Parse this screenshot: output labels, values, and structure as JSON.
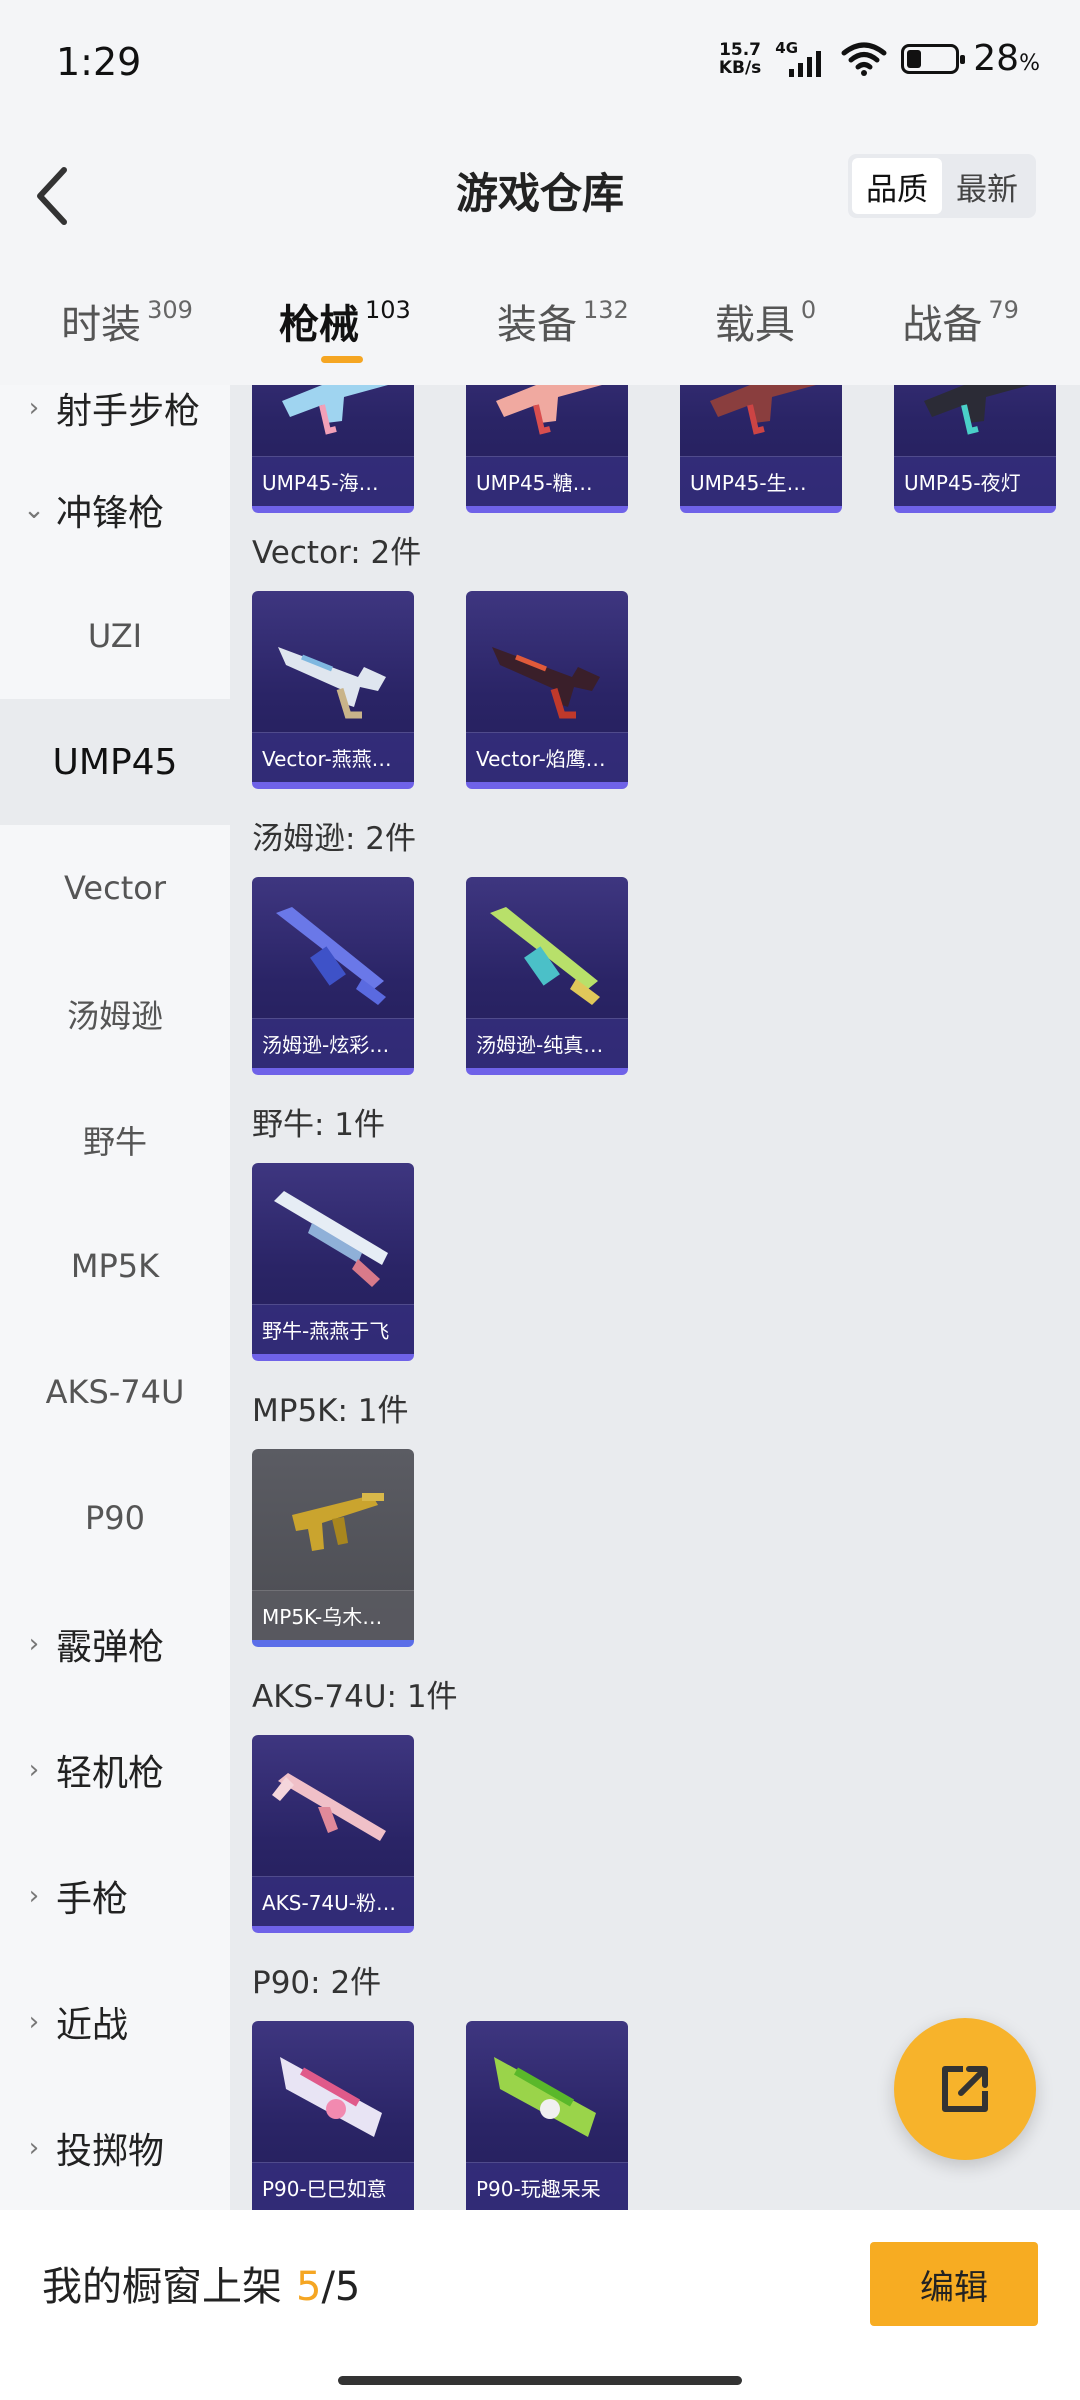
{
  "status_bar": {
    "time": "1:29",
    "net_speed_value": "15.7",
    "net_speed_unit": "KB/s",
    "network_type": "4G",
    "battery_percent": "28",
    "battery_unit": "%"
  },
  "header": {
    "title": "游戏仓库",
    "back_icon": "chevron-left-icon",
    "sort_options": [
      "品质",
      "最新"
    ],
    "sort_selected": "品质"
  },
  "tabs": [
    {
      "label": "时装",
      "count": "309"
    },
    {
      "label": "枪械",
      "count": "103",
      "active": true
    },
    {
      "label": "装备",
      "count": "132"
    },
    {
      "label": "载具",
      "count": "0"
    },
    {
      "label": "战备",
      "count": "79"
    }
  ],
  "sidebar": {
    "items": [
      {
        "label": "射手步枪",
        "type": "group"
      },
      {
        "label": "冲锋枪",
        "type": "group",
        "expanded": true
      },
      {
        "label": "UZI",
        "type": "sub"
      },
      {
        "label": "UMP45",
        "type": "sub",
        "active": true
      },
      {
        "label": "Vector",
        "type": "sub"
      },
      {
        "label": "汤姆逊",
        "type": "sub"
      },
      {
        "label": "野牛",
        "type": "sub"
      },
      {
        "label": "MP5K",
        "type": "sub"
      },
      {
        "label": "AKS-74U",
        "type": "sub"
      },
      {
        "label": "P90",
        "type": "sub"
      },
      {
        "label": "霰弹枪",
        "type": "group"
      },
      {
        "label": "轻机枪",
        "type": "group"
      },
      {
        "label": "手枪",
        "type": "group"
      },
      {
        "label": "近战",
        "type": "group"
      },
      {
        "label": "投掷物",
        "type": "group"
      }
    ]
  },
  "content": {
    "sections": [
      {
        "label": "",
        "items": [
          "UMP45-海…",
          "UMP45-糖…",
          "UMP45-生…",
          "UMP45-夜灯"
        ]
      },
      {
        "label": "Vector: 2件",
        "items": [
          "Vector-燕燕…",
          "Vector-焰鹰…"
        ]
      },
      {
        "label": "汤姆逊: 2件",
        "items": [
          "汤姆逊-炫彩…",
          "汤姆逊-纯真…"
        ]
      },
      {
        "label": "野牛: 1件",
        "items": [
          "野牛-燕燕于飞"
        ]
      },
      {
        "label": "MP5K: 1件",
        "items": [
          "MP5K-乌木…"
        ],
        "grey": true
      },
      {
        "label": "AKS-74U: 1件",
        "items": [
          "AKS-74U-粉…"
        ]
      },
      {
        "label": "P90: 2件",
        "items": [
          "P90-巳巳如意",
          "P90-玩趣呆呆"
        ]
      }
    ]
  },
  "fab": {
    "icon": "share-out-icon"
  },
  "bottom_bar": {
    "showcase_label": "我的橱窗上架",
    "showcase_current": "5",
    "showcase_total": "/5",
    "edit_label": "编辑"
  },
  "colors": {
    "accent": "#f5a623",
    "card_purple": "#2a2466",
    "card_border": "#6f62e8"
  }
}
